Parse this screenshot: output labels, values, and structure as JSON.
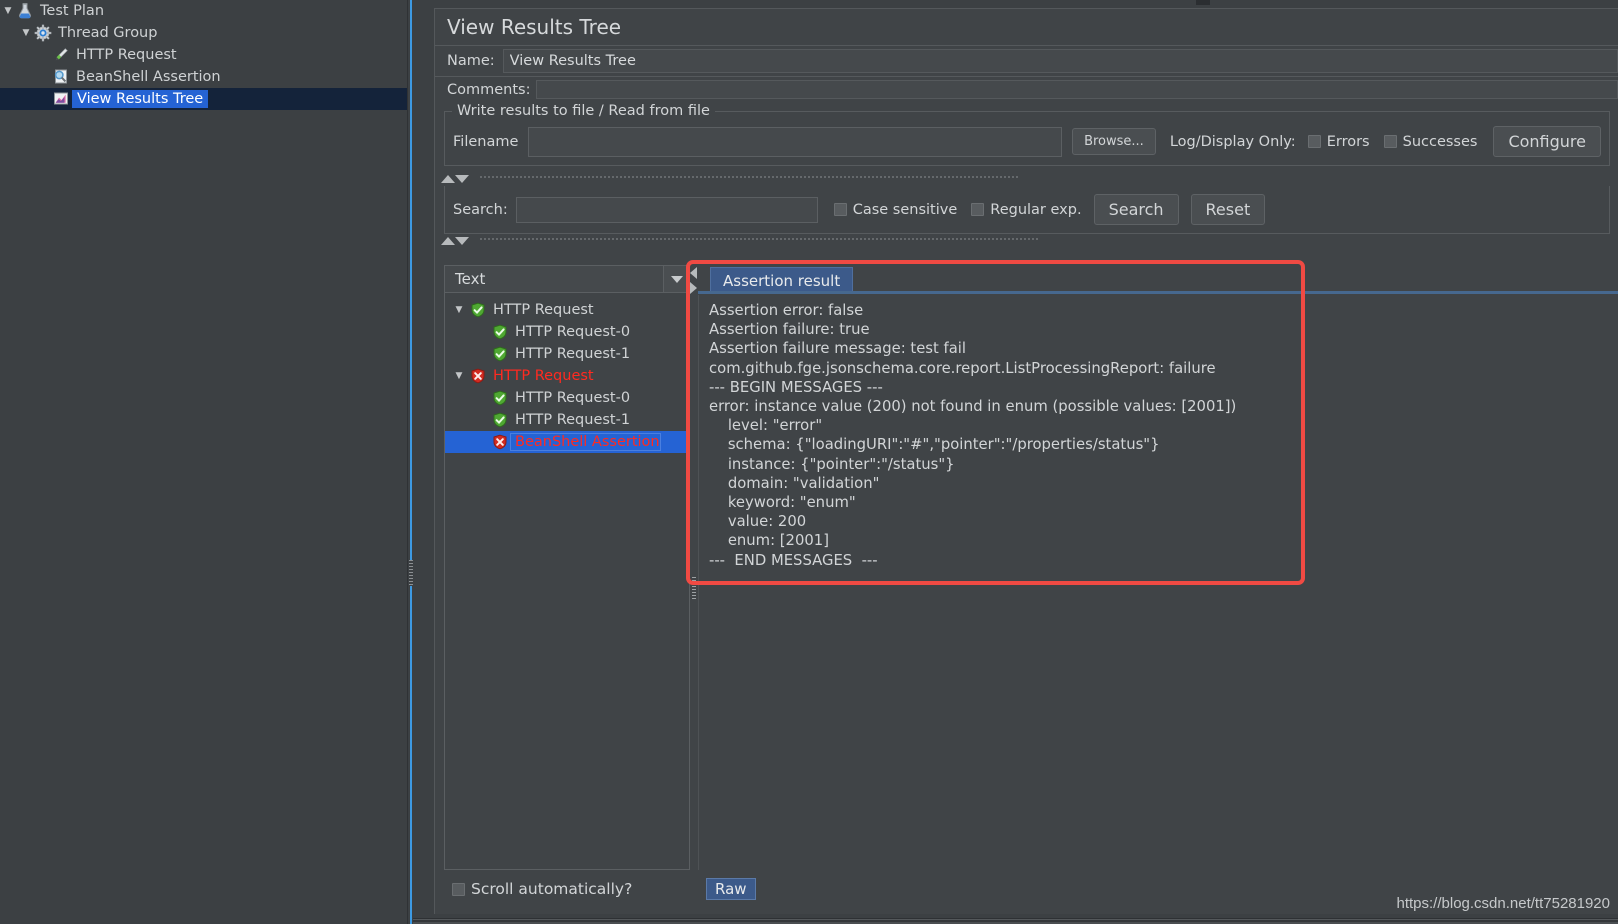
{
  "tree": {
    "items": [
      {
        "label": "Test Plan",
        "icon": "test-plan-icon",
        "indent": 0,
        "twisty": "▼",
        "selected": false
      },
      {
        "label": "Thread Group",
        "icon": "thread-group-icon",
        "indent": 1,
        "twisty": "▼",
        "selected": false
      },
      {
        "label": "HTTP Request",
        "icon": "http-request-icon",
        "indent": 2,
        "twisty": "",
        "selected": false
      },
      {
        "label": "BeanShell Assertion",
        "icon": "beanshell-assertion-icon",
        "indent": 2,
        "twisty": "",
        "selected": false
      },
      {
        "label": "View Results Tree",
        "icon": "view-results-tree-icon",
        "indent": 2,
        "twisty": "",
        "selected": true
      }
    ]
  },
  "panel": {
    "title": "View Results Tree",
    "name_label": "Name:",
    "name_value": "View Results Tree",
    "comments_label": "Comments:",
    "comments_value": "",
    "write_group_legend": "Write results to file / Read from file",
    "filename_label": "Filename",
    "filename_value": "",
    "filename_placeholder": "",
    "browse_label": "Browse...",
    "log_display_label": "Log/Display Only:",
    "errors_label": "Errors",
    "errors_checked": false,
    "successes_label": "Successes",
    "successes_checked": false,
    "configure_label": "Configure"
  },
  "search": {
    "label": "Search:",
    "value": "",
    "placeholder": "",
    "case_sensitive_label": "Case sensitive",
    "case_sensitive_checked": false,
    "regex_label": "Regular exp.",
    "regex_checked": false,
    "search_button": "Search",
    "reset_button": "Reset"
  },
  "results": {
    "renderer_selected": "Text",
    "scroll_auto_label": "Scroll automatically?",
    "scroll_auto_checked": false,
    "raw_button": "Raw",
    "tree_rows": [
      {
        "label": "HTTP Request",
        "status": "pass",
        "indent": 0,
        "twisty": "▼",
        "selected": false
      },
      {
        "label": "HTTP Request-0",
        "status": "pass",
        "indent": 1,
        "twisty": "",
        "selected": false
      },
      {
        "label": "HTTP Request-1",
        "status": "pass",
        "indent": 1,
        "twisty": "",
        "selected": false
      },
      {
        "label": "HTTP Request",
        "status": "fail",
        "indent": 0,
        "twisty": "▼",
        "selected": false
      },
      {
        "label": "HTTP Request-0",
        "status": "pass",
        "indent": 1,
        "twisty": "",
        "selected": false
      },
      {
        "label": "HTTP Request-1",
        "status": "pass",
        "indent": 1,
        "twisty": "",
        "selected": false
      },
      {
        "label": "BeanShell Assertion",
        "status": "fail",
        "indent": 1,
        "twisty": "",
        "selected": true
      }
    ],
    "tabs": [
      {
        "label": "Assertion result",
        "active": true
      }
    ],
    "detail_text": "Assertion error: false\nAssertion failure: true\nAssertion failure message: test fail\ncom.github.fge.jsonschema.core.report.ListProcessingReport: failure\n--- BEGIN MESSAGES ---\nerror: instance value (200) not found in enum (possible values: [2001])\n    level: \"error\"\n    schema: {\"loadingURI\":\"#\",\"pointer\":\"/properties/status\"}\n    instance: {\"pointer\":\"/status\"}\n    domain: \"validation\"\n    keyword: \"enum\"\n    value: 200\n    enum: [2001]\n---  END MESSAGES  ---"
  },
  "watermark": "https://blog.csdn.net/tt75281920",
  "colors": {
    "background": "#3c4043",
    "panel": "#404447",
    "selection_blue": "#2563d4",
    "tab_blue": "#3c5a8a",
    "fail_red": "#ff2a20",
    "highlight_red": "#f04a43",
    "divider_blue": "#3d9ae3",
    "text": "#d2d5d7"
  }
}
